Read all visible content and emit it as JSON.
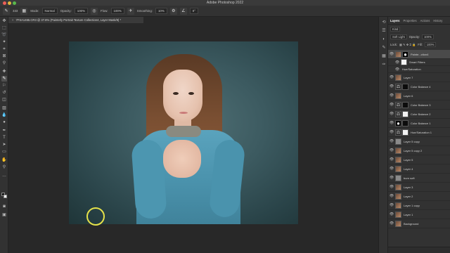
{
  "app": {
    "title": "Adobe Photoshop 2022"
  },
  "options_bar": {
    "brush_size": "333",
    "mode_label": "Mode:",
    "mode_value": "Normal",
    "opacity_label": "Opacity:",
    "opacity_value": "100%",
    "flow_label": "Flow:",
    "flow_value": "100%",
    "smoothing_label": "Smoothing:",
    "smoothing_value": "10%",
    "angle_value": "0°"
  },
  "document_tab": {
    "close_glyph": "×",
    "title": "7FSA1465.CR3 @ 37.8% (Painterly Portrait Texture Collection4, Layer Mask/8) *"
  },
  "layers_panel": {
    "tabs": [
      "Layers",
      "Properties",
      "Actions",
      "History"
    ],
    "active_tab": "Layers",
    "filter_label": "Kind",
    "blend_mode": "Soft Light",
    "opacity_label": "Opacity:",
    "opacity_value": "100%",
    "lock_label": "Lock:",
    "fill_label": "Fill:",
    "fill_value": "100%",
    "layers": [
      {
        "name": "Painte...ction4",
        "thumb": "photo",
        "selected": true
      },
      {
        "name": "Smart Filters",
        "thumb": "white",
        "sub": true
      },
      {
        "name": "Hue/Saturation",
        "thumb": "",
        "sub": true
      },
      {
        "name": "Layer 7",
        "thumb": "photo"
      },
      {
        "name": "Color Balance 4",
        "thumb": "adj"
      },
      {
        "name": "Layer 6",
        "thumb": "photo"
      },
      {
        "name": "Color Balance 3",
        "thumb": "adj"
      },
      {
        "name": "Color Balance 2",
        "thumb": "adj"
      },
      {
        "name": "Color Balance 1",
        "thumb": "mask"
      },
      {
        "name": "Hue/Saturation 1",
        "thumb": "adj"
      },
      {
        "name": "Layer 5 copy",
        "thumb": "gray"
      },
      {
        "name": "Layer 5 copy 2",
        "thumb": "photo"
      },
      {
        "name": "Layer 5",
        "thumb": "photo"
      },
      {
        "name": "Layer 4",
        "thumb": "photo"
      },
      {
        "name": "burn soft",
        "thumb": "gray"
      },
      {
        "name": "Layer 3",
        "thumb": "photo"
      },
      {
        "name": "Layer 2",
        "thumb": "photo"
      },
      {
        "name": "Layer 1 copy",
        "thumb": "photo"
      },
      {
        "name": "Layer 1",
        "thumb": "photo"
      },
      {
        "name": "Background",
        "thumb": "photo"
      }
    ]
  },
  "colors": {
    "foreground": "#111111",
    "background": "#ffffff",
    "brush_cursor": "#e6e24a"
  }
}
